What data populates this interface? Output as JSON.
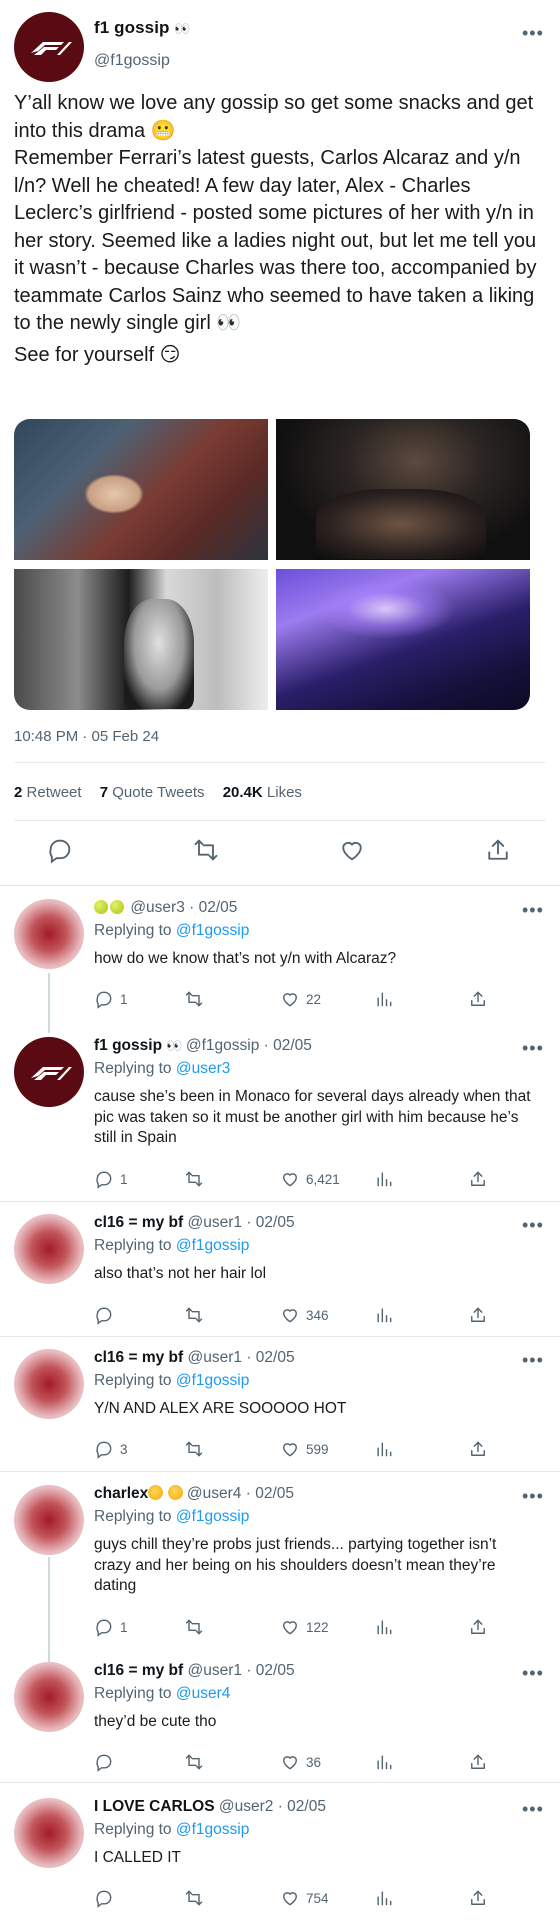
{
  "main_tweet": {
    "name": "f1 gossip",
    "name_emoji": "👀",
    "handle": "@f1gossip",
    "more_label": "•••",
    "text_lines": [
      "Y’all know we love any gossip so get some snacks and get into this drama 😬",
      "Remember Ferrari’s latest guests, Carlos Alcaraz and y/n l/n? Well he cheated! A few day later, Alex - Charles Leclerc’s girlfriend - posted some pictures of her with y/n in her story. Seemed like a ladies night out, but let me tell you it wasn’t - because Charles was there too, accompanied by teammate Carlos Sainz who seemed to have taken a liking to the newly single girl 👀",
      "See for yourself 😏"
    ],
    "timestamp": "10:48 PM · 05 Feb 24",
    "stats": {
      "retweets_count": "2",
      "retweets_label": "Retweet",
      "quotes_count": "7",
      "quotes_label": "Quote Tweets",
      "likes_count": "20.4K",
      "likes_label": "Likes"
    }
  },
  "replies": [
    {
      "name": "",
      "name_emojis": "tennis-ball x2",
      "handle": "@user3",
      "date": "· 02/05",
      "replying_label": "Replying to",
      "replying_to": "@f1gossip",
      "text": "how do we know that’s not y/n with Alcaraz?",
      "counts": {
        "replies": "1",
        "retweets": "",
        "likes": "22"
      }
    },
    {
      "name": "f1 gossip",
      "name_emoji": "👀",
      "handle": "@f1gossip",
      "date": "· 02/05",
      "replying_label": "Replying to",
      "replying_to": "@user3",
      "text": "cause she’s been in Monaco for several days already when that pic was taken so it must be another girl with him because he’s still in Spain",
      "counts": {
        "replies": "1",
        "retweets": "",
        "likes": "6,421"
      }
    },
    {
      "name": "cl16 = my bf",
      "handle": "@user1",
      "date": "· 02/05",
      "replying_label": "Replying to",
      "replying_to": "@f1gossip",
      "text": "also that’s not her hair lol",
      "counts": {
        "replies": "",
        "retweets": "",
        "likes": "346"
      }
    },
    {
      "name": "cl16 = my bf",
      "handle": "@user1",
      "date": "· 02/05",
      "replying_label": "Replying to",
      "replying_to": "@f1gossip",
      "text": "Y/N AND ALEX ARE SOOOOO HOT",
      "counts": {
        "replies": "3",
        "retweets": "",
        "likes": "599"
      }
    },
    {
      "name": "charlex",
      "name_emojis": "😔😔",
      "handle": "@user4",
      "date": "· 02/05",
      "replying_label": "Replying to",
      "replying_to": "@f1gossip",
      "text": "guys chill they’re probs just friends... partying together isn’t crazy and her being on his shoulders doesn’t mean they’re dating",
      "counts": {
        "replies": "1",
        "retweets": "",
        "likes": "122"
      }
    },
    {
      "name": "cl16 = my bf",
      "handle": "@user1",
      "date": "· 02/05",
      "replying_label": "Replying to",
      "replying_to": "@user4",
      "text": "they’d be cute tho",
      "counts": {
        "replies": "",
        "retweets": "",
        "likes": "36"
      }
    },
    {
      "name": "I LOVE CARLOS",
      "handle": "@user2",
      "date": "· 02/05",
      "replying_label": "Replying to",
      "replying_to": "@f1gossip",
      "text": "I CALLED IT",
      "counts": {
        "replies": "",
        "retweets": "",
        "likes": "754"
      }
    }
  ],
  "icons": {
    "reply": "reply-icon",
    "retweet": "retweet-icon",
    "like": "heart-icon",
    "views": "views-icon",
    "share": "share-icon",
    "more": "more-icon"
  },
  "colors": {
    "link": "#1d9bf0",
    "secondary_text": "#536471",
    "f1_avatar": "#5a0a12"
  }
}
